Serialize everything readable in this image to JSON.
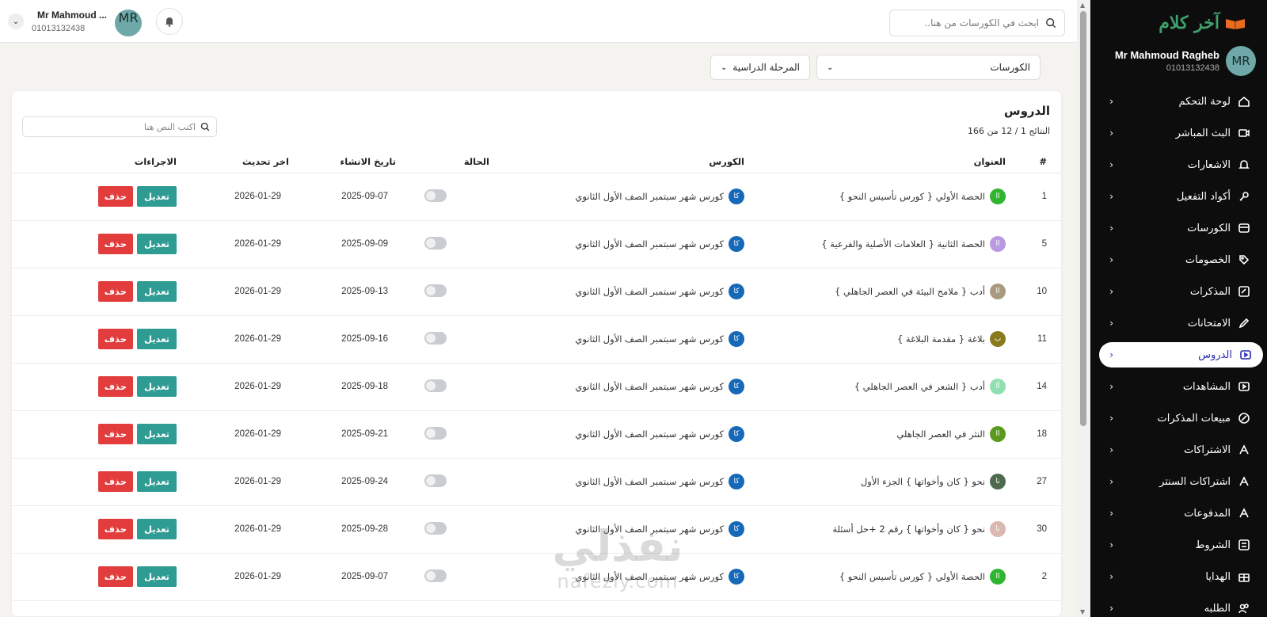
{
  "sidebar": {
    "logo_text": "آخر كلام",
    "user": {
      "initials": "MR",
      "name": "Mr Mahmoud Ragheb",
      "phone": "01013132438"
    },
    "items": [
      {
        "label": "لوحة التحكم",
        "icon": "home-icon"
      },
      {
        "label": "البث المباشر",
        "icon": "video-icon"
      },
      {
        "label": "الاشعارات",
        "icon": "bell-icon"
      },
      {
        "label": "أكواد التفعيل",
        "icon": "key-icon"
      },
      {
        "label": "الكورسات",
        "icon": "courses-icon"
      },
      {
        "label": "الخصومات",
        "icon": "tag-icon"
      },
      {
        "label": "المذكرات",
        "icon": "notes-icon"
      },
      {
        "label": "الامتحانات",
        "icon": "pen-icon"
      },
      {
        "label": "الدروس",
        "icon": "lessons-icon",
        "active": true
      },
      {
        "label": "المشاهدات",
        "icon": "views-icon"
      },
      {
        "label": "مبيعات المذكرات",
        "icon": "percent-icon"
      },
      {
        "label": "الاشتراكات",
        "icon": "subscriptions-icon"
      },
      {
        "label": "اشتراكات السنتر",
        "icon": "center-subscriptions-icon"
      },
      {
        "label": "المدفوعات",
        "icon": "payments-icon"
      },
      {
        "label": "الشروط",
        "icon": "terms-icon"
      },
      {
        "label": "الهدايا",
        "icon": "gift-icon"
      },
      {
        "label": "الطلبه",
        "icon": "students-icon"
      }
    ]
  },
  "topbar": {
    "search_placeholder": "ابحث في الكورسات من هنا..",
    "user_name": "Mr Mahmoud ...",
    "user_phone": "01013132438",
    "avatar_initials": "MR"
  },
  "filters": {
    "courses": "الكورسات",
    "stage": "المرحلة الدراسية"
  },
  "card": {
    "title": "الدروس",
    "results": "النتائج 1 / 12 من 166",
    "search_placeholder": "اكتب النص هنا"
  },
  "table": {
    "headers": {
      "num": "#",
      "title": "العنوان",
      "course": "الكورس",
      "status": "الحالة",
      "created": "تاريخ الانشاء",
      "updated": "اخر تحديث",
      "actions": "الاجراءات"
    },
    "edit_label": "تعديل",
    "delete_label": "حذف",
    "rows": [
      {
        "num": "1",
        "badge": "اا",
        "badge_color": "#2fb52f",
        "title": "الحصة الأولي { كورس تأسيس النحو }",
        "course_badge": "كا",
        "course": "كورس شهر سبتمبر الصف الأول الثانوي",
        "created": "2025-09-07",
        "updated": "2026-01-29"
      },
      {
        "num": "5",
        "badge": "اا",
        "badge_color": "#b79ae0",
        "title": "الحصة الثانية { العلامات الأصلية والفرعية }",
        "course_badge": "كا",
        "course": "كورس شهر سبتمبر الصف الأول الثانوي",
        "created": "2025-09-09",
        "updated": "2026-01-29"
      },
      {
        "num": "10",
        "badge": "اا",
        "badge_color": "#a89a7e",
        "title": "أدب { ملامح البيئة في العصر الجاهلي }",
        "course_badge": "كا",
        "course": "كورس شهر سبتمبر الصف الأول الثانوي",
        "created": "2025-09-13",
        "updated": "2026-01-29"
      },
      {
        "num": "11",
        "badge": "ب",
        "badge_color": "#8a7a1e",
        "title": "بلاغة { مقدمة البلاغة }",
        "course_badge": "كا",
        "course": "كورس شهر سبتمبر الصف الأول الثانوي",
        "created": "2025-09-16",
        "updated": "2026-01-29"
      },
      {
        "num": "14",
        "badge": "أا",
        "badge_color": "#8fe0b0",
        "title": "أدب { الشعر في العصر الجاهلي }",
        "course_badge": "كا",
        "course": "كورس شهر سبتمبر الصف الأول الثانوي",
        "created": "2025-09-18",
        "updated": "2026-01-29"
      },
      {
        "num": "18",
        "badge": "اا",
        "badge_color": "#5a9a1e",
        "title": "النثر في العصر الجاهلي",
        "course_badge": "كا",
        "course": "كورس شهر سبتمبر الصف الأول الثانوي",
        "created": "2025-09-21",
        "updated": "2026-01-29"
      },
      {
        "num": "27",
        "badge": "نا",
        "badge_color": "#4d6a4d",
        "title": "نحو { كان وأخواتها } الجزء الأول",
        "course_badge": "كا",
        "course": "كورس شهر سبتمبر الصف الأول الثانوي",
        "created": "2025-09-24",
        "updated": "2026-01-29"
      },
      {
        "num": "30",
        "badge": "نا",
        "badge_color": "#d9b9b0",
        "title": "نحو { كان وأخواتها } رقم 2 +حل أسئلة",
        "course_badge": "كا",
        "course": "كورس شهر سبتمبر الصف الأول الثانوي",
        "created": "2025-09-28",
        "updated": "2026-01-29"
      },
      {
        "num": "2",
        "badge": "اا",
        "badge_color": "#2fb52f",
        "title": "الحصة الأولي { كورس تأسيس النحو }",
        "course_badge": "كا",
        "course": "كورس شهر سبتمبر الصف الأول الثانوي",
        "created": "2025-09-07",
        "updated": "2026-01-29"
      }
    ]
  },
  "watermark": {
    "arabic": "نفذلي",
    "latin": "nafezly.com"
  }
}
